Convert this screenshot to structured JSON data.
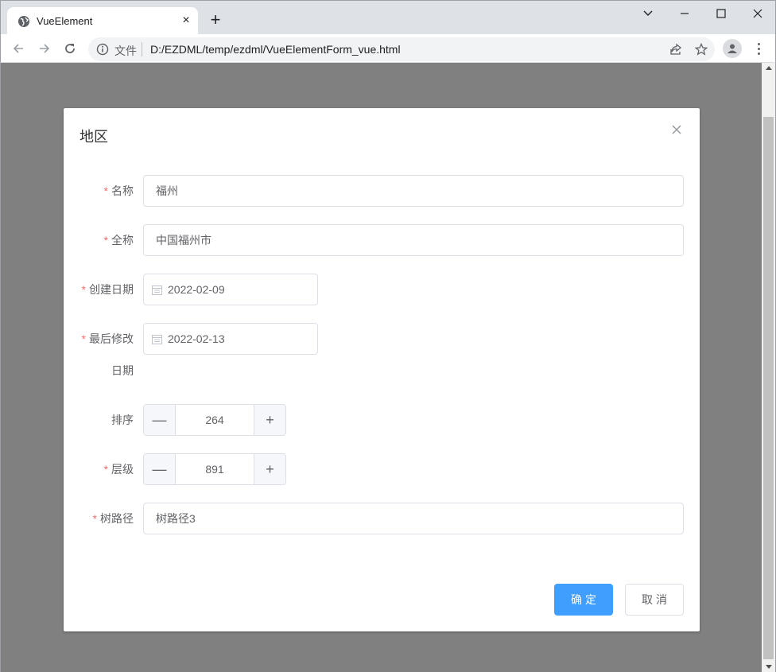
{
  "browser": {
    "tab_title": "VueElement",
    "tab_close": "×",
    "new_tab": "+",
    "scheme_label": "文件",
    "url": "D:/EZDML/temp/ezdml/VueElementForm_vue.html"
  },
  "dialog": {
    "title": "地区",
    "fields": {
      "name": {
        "label": "名称",
        "required": "*",
        "value": "福州"
      },
      "full_name": {
        "label": "全称",
        "required": "*",
        "value": "中国福州市"
      },
      "created": {
        "label": "创建日期",
        "required": "*",
        "value": "2022-02-09"
      },
      "modified": {
        "label_line1": "最后修改",
        "label_line2": "日期",
        "required": "*",
        "value": "2022-02-13"
      },
      "sort": {
        "label": "排序",
        "value": "264",
        "dec": "—",
        "inc": "+"
      },
      "level": {
        "label": "层级",
        "required": "*",
        "value": "891",
        "dec": "—",
        "inc": "+"
      },
      "tree_path": {
        "label": "树路径",
        "required": "*",
        "value": "树路径3"
      }
    },
    "buttons": {
      "confirm": "确定",
      "cancel": "取消"
    }
  },
  "colors": {
    "primary": "#409eff",
    "required": "#f56c6c",
    "overlay": "#808080"
  }
}
